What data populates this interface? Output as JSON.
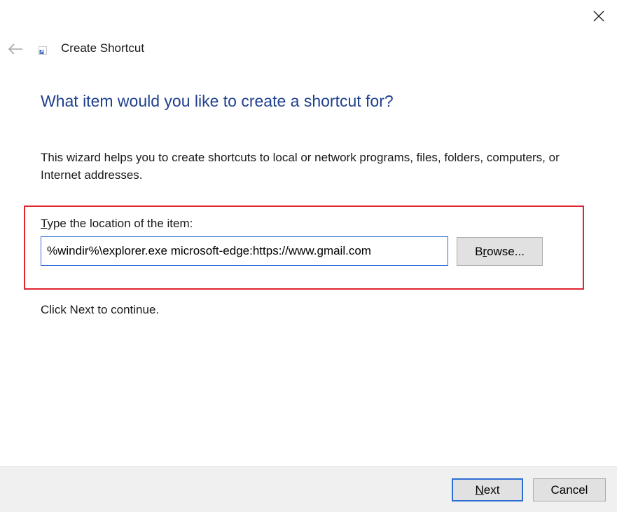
{
  "window": {
    "title": "Create Shortcut",
    "close_label": "×"
  },
  "main": {
    "heading": "What item would you like to create a shortcut for?",
    "description": "This wizard helps you to create shortcuts to local or network programs, files, folders, computers, or Internet addresses.",
    "location_label_mnemonic": "T",
    "location_label_rest": "ype the location of the item:",
    "location_value": "%windir%\\explorer.exe microsoft-edge:https://www.gmail.com",
    "browse_mnemonic": "r",
    "browse_before": "B",
    "browse_after": "owse...",
    "continue_text": "Click Next to continue."
  },
  "footer": {
    "next_mnemonic": "N",
    "next_rest": "ext",
    "cancel_label": "Cancel"
  },
  "colors": {
    "heading": "#1f3f8f",
    "highlight": "#e0242f",
    "focus": "#2c6ed3",
    "button_bg": "#e1e1e1",
    "footer_bg": "#f0f0f0"
  },
  "icons": {
    "close": "close-icon",
    "back": "back-arrow-icon",
    "app": "shortcut-icon"
  }
}
